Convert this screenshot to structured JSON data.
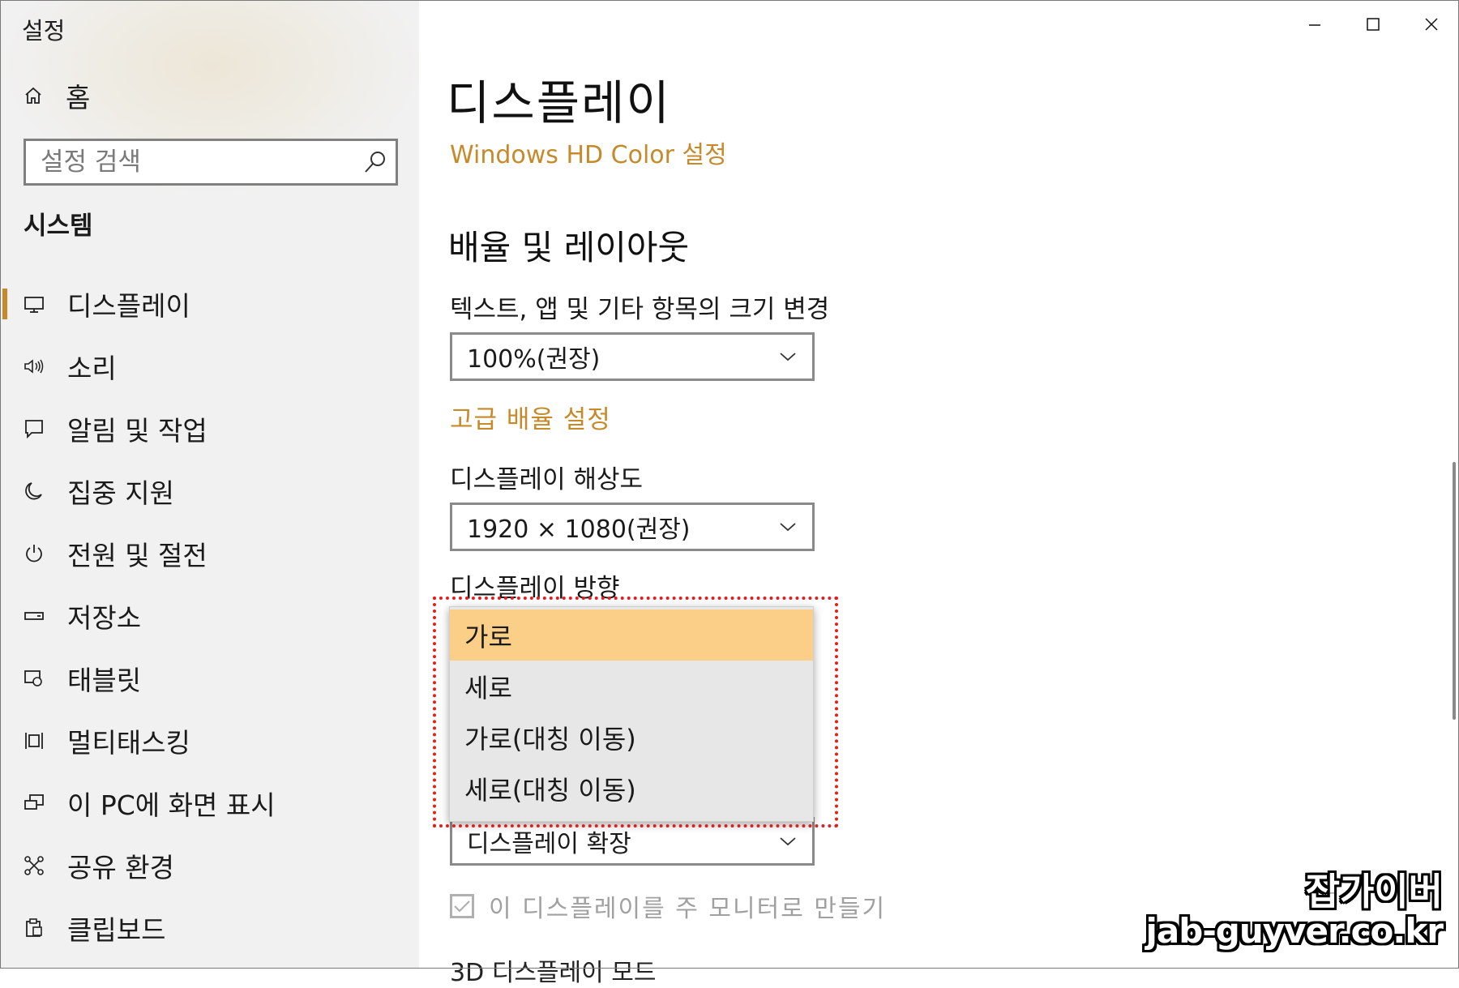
{
  "app": {
    "title": "설정"
  },
  "window_controls": [
    "minimize",
    "maximize",
    "close"
  ],
  "sidebar": {
    "home_label": "홈",
    "search_placeholder": "설정 검색",
    "section_title": "시스템",
    "items": [
      {
        "label": "디스플레이",
        "icon": "monitor-icon",
        "active": true
      },
      {
        "label": "소리",
        "icon": "speaker-icon",
        "active": false
      },
      {
        "label": "알림 및 작업",
        "icon": "notification-icon",
        "active": false
      },
      {
        "label": "집중 지원",
        "icon": "moon-icon",
        "active": false
      },
      {
        "label": "전원 및 절전",
        "icon": "power-icon",
        "active": false
      },
      {
        "label": "저장소",
        "icon": "storage-icon",
        "active": false
      },
      {
        "label": "태블릿",
        "icon": "tablet-icon",
        "active": false
      },
      {
        "label": "멀티태스킹",
        "icon": "multitasking-icon",
        "active": false
      },
      {
        "label": "이 PC에 화면 표시",
        "icon": "project-icon",
        "active": false
      },
      {
        "label": "공유 환경",
        "icon": "shared-icon",
        "active": false
      },
      {
        "label": "클립보드",
        "icon": "clipboard-icon",
        "active": false
      }
    ]
  },
  "main": {
    "title": "디스플레이",
    "hd_color_link": "Windows HD Color 설정",
    "scale_section_title": "배율 및 레이아웃",
    "scale_label": "텍스트, 앱 및 기타 항목의 크기 변경",
    "scale_value": "100%(권장)",
    "advanced_scale_link": "고급 배율 설정",
    "resolution_label": "디스플레이 해상도",
    "resolution_value": "1920 × 1080(권장)",
    "orientation_label": "디스플레이 방향",
    "orientation_options": [
      "가로",
      "세로",
      "가로(대칭 이동)",
      "세로(대칭 이동)"
    ],
    "orientation_selected": "가로",
    "multi_display_value": "디스플레이 확장",
    "main_monitor_checkbox_label": "이 디스플레이를 주 모니터로 만들기",
    "main_monitor_checked": true,
    "next_section_partial": "3D 디스플레이 모드"
  },
  "watermark": {
    "line1": "잡가이버",
    "line2": "jab-guyver.co.kr"
  },
  "colors": {
    "accent": "#c68a2a",
    "selected_option": "#fbcf88",
    "highlight_border": "#e02020"
  }
}
